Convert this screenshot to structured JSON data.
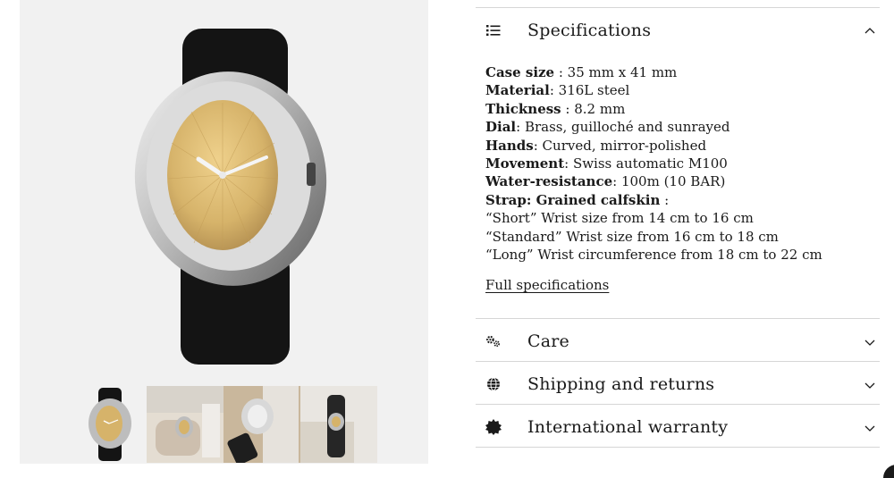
{
  "gallery": {
    "thumbnails": [
      {
        "label": "Watch front view"
      },
      {
        "label": "Watch worn on wrist"
      },
      {
        "label": "Watch caseback detail"
      },
      {
        "label": "Watch on wrist side"
      }
    ],
    "dial_color": "#d6b36a",
    "strap_color": "#151515",
    "case_color": "#c9c9c9"
  },
  "accordion": {
    "specifications": {
      "title": "Specifications",
      "icon": "list-icon",
      "expanded": true,
      "items": [
        {
          "label": "Case size",
          "value": " : 35 mm x 41 mm"
        },
        {
          "label": "Material",
          "value": ": 316L steel"
        },
        {
          "label": "Thickness",
          "value": " : 8.2 mm"
        },
        {
          "label": "Dial",
          "value": ": Brass, guilloché and sunrayed"
        },
        {
          "label": "Hands",
          "value": ": Curved, mirror-polished"
        },
        {
          "label": "Movement",
          "value": ": Swiss automatic M100"
        },
        {
          "label": "Water-resistance",
          "value": ": 100m (10 BAR)"
        },
        {
          "label": "Strap: Grained calfskin",
          "value": " :"
        }
      ],
      "strap_sizes": [
        "“Short” Wrist size from 14 cm to 16 cm",
        "“Standard” Wrist size from 16 cm to 18 cm",
        "“Long” Wrist circumference from 18 cm to 22 cm"
      ],
      "link_label": "Full specifications"
    },
    "care": {
      "title": "Care",
      "icon": "gears-icon",
      "expanded": false
    },
    "shipping": {
      "title": "Shipping and returns",
      "icon": "globe-icon",
      "expanded": false
    },
    "warranty": {
      "title": "International warranty",
      "icon": "badge-icon",
      "expanded": false
    }
  }
}
